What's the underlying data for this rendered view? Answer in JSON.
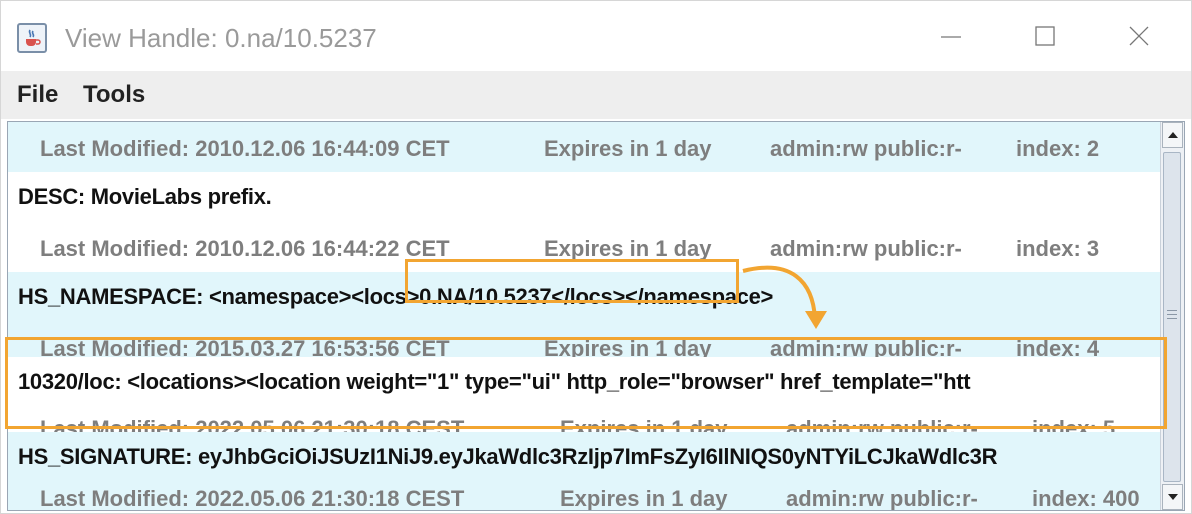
{
  "window": {
    "title": "View Handle: 0.na/10.5237",
    "app_icon": "java-cup-icon",
    "controls": [
      "minimize-icon",
      "maximize-icon",
      "close-icon"
    ]
  },
  "menu": [
    {
      "label": "File"
    },
    {
      "label": "Tools"
    }
  ],
  "records": [
    {
      "value": null,
      "meta": {
        "modified": "Last Modified: 2010.12.06 16:44:09 CET",
        "expires": "Expires in 1 day",
        "perms": "admin:rw public:r-",
        "index": "index: 2"
      }
    },
    {
      "value": "DESC: MovieLabs prefix.",
      "meta": {
        "modified": "Last Modified: 2010.12.06 16:44:22 CET",
        "expires": "Expires in 1 day",
        "perms": "admin:rw public:r-",
        "index": "index: 3"
      }
    },
    {
      "value_prefix": "HS_NAMESPACE: <namespace>",
      "value_highlight": "<locs>0.NA/10.5237</locs>",
      "value_suffix": "</namespace>",
      "meta": {
        "modified": "Last Modified: 2015.03.27 16:53:56 CET",
        "expires": "Expires in 1 day",
        "perms": "admin:rw public:r-",
        "index": "index: 4"
      }
    },
    {
      "value": "10320/loc: <locations><location weight=\"1\" type=\"ui\" http_role=\"browser\" href_template=\"htt",
      "meta": {
        "modified": "Last Modified: 2022.05.06 21:30:18 CEST",
        "expires": "Expires in 1 day",
        "perms": "admin:rw public:r-",
        "index": "index: 5"
      }
    },
    {
      "value": "HS_SIGNATURE: eyJhbGciOiJSUzI1NiJ9.eyJkaWdlc3RzIjp7ImFsZyI6IlNIQS0yNTYiLCJkaWdlc3R",
      "meta": {
        "modified": "Last Modified: 2022.05.06 21:30:18 CEST",
        "expires": "Expires in 1 day",
        "perms": "admin:rw public:r-",
        "index": "index: 400"
      }
    }
  ],
  "colors": {
    "row_alt": "#e1f6fb",
    "highlight": "#f2a531",
    "meta_text": "#7e7e7e"
  }
}
